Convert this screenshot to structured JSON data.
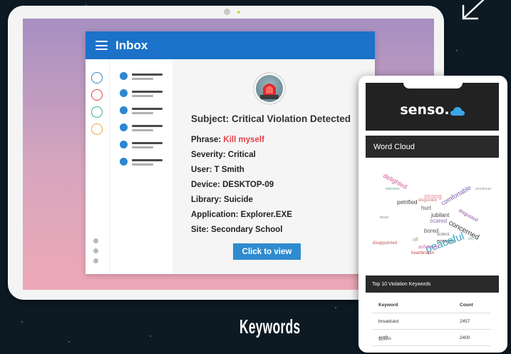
{
  "inbox": {
    "title": "Inbox",
    "subject": "Subject: Critical Violation Detected",
    "fields": [
      {
        "label": "Phrase:",
        "value": "Kill myself",
        "highlight": true
      },
      {
        "label": "Severity:",
        "value": "Critical"
      },
      {
        "label": "User:",
        "value": "T Smith"
      },
      {
        "label": "Device:",
        "value": "DESKTOP-09"
      },
      {
        "label": "Library:",
        "value": "Suicide"
      },
      {
        "label": "Application:",
        "value": "Explorer.EXE"
      },
      {
        "label": "Site:",
        "value": "Secondary School"
      }
    ],
    "button": "Click to view",
    "folder_colors": [
      "#2c86d0",
      "#e8424a",
      "#2cb585",
      "#f0a23c"
    ]
  },
  "phone": {
    "brand": "senso.",
    "word_cloud_title": "Word Cloud",
    "words": [
      "peaceful",
      "concerned",
      "delighted",
      "comfortable",
      "petrified",
      "jubilant",
      "ashamed",
      "heartbroken",
      "disappointed",
      "strong",
      "disgusted",
      "scared",
      "bored",
      "hurt",
      "violent",
      "enraged",
      "off"
    ],
    "table_title": "Top 10 Violation Keywords",
    "table": {
      "headers": [
        "Keyword",
        "Count"
      ],
      "rows": [
        [
          "broadcast",
          "2457"
        ],
        [
          "妨碍ls",
          "2400"
        ]
      ]
    }
  },
  "caption": "Keywords",
  "colors": {
    "accent": "#1b72c8",
    "highlight": "#e8424a",
    "background": "#0d1a24"
  }
}
